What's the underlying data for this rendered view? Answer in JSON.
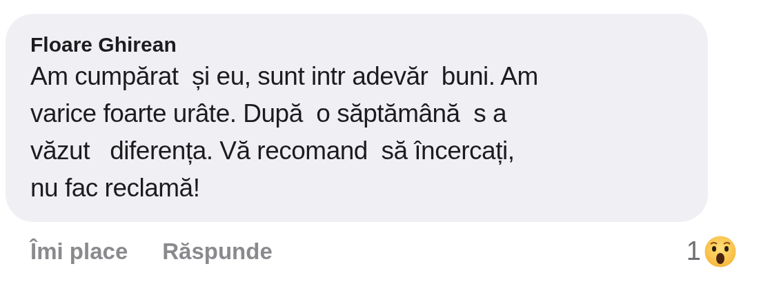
{
  "comment": {
    "author": "Floare Ghirean",
    "text": "Am cumpărat  și eu, sunt intr adevăr  buni. Am\nvarice foarte urâte. După  o săptămână  s a\nvăzut   diferența. Vă recomand  să încercați,\nnu fac reclamă!"
  },
  "actions": [
    {
      "label": "Îmi place"
    },
    {
      "label": "Răspunde"
    }
  ],
  "reactions": {
    "count": "1"
  }
}
